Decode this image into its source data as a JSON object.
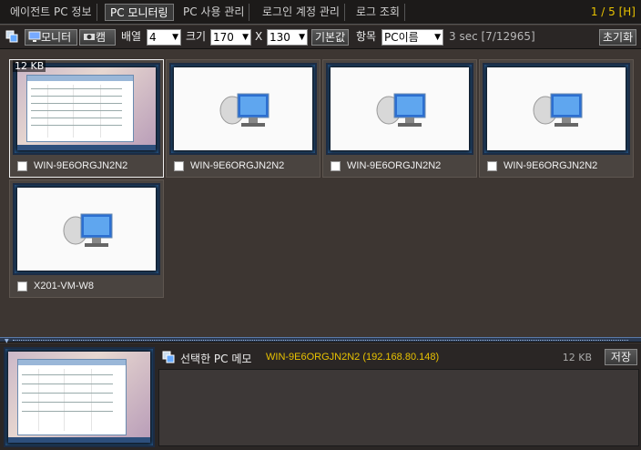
{
  "tabs": [
    {
      "label": "에이전트 PC 정보"
    },
    {
      "label": "PC 모니터링"
    },
    {
      "label": "PC 사용 관리"
    },
    {
      "label": "로그인 계정 관리"
    },
    {
      "label": "로그 조회"
    }
  ],
  "pager": "1 / 5 [H]",
  "toolbar": {
    "monitor_label": "모니터",
    "cam_label": "캠",
    "array_label": "배열",
    "array_value": "4",
    "size_label": "크기",
    "width_value": "170",
    "times": "X",
    "height_value": "130",
    "default_label": "기본값",
    "item_label": "항목",
    "item_value": "PC이름",
    "status": "3 sec [7/12965]",
    "reset_label": "초기화"
  },
  "thumbnails": [
    {
      "name": "WIN-9E6ORGJN2N2",
      "size": "12 KB",
      "preview": "desktop-screenshot"
    },
    {
      "name": "WIN-9E6ORGJN2N2",
      "preview": "network-computer-icon"
    },
    {
      "name": "WIN-9E6ORGJN2N2",
      "preview": "network-computer-icon"
    },
    {
      "name": "WIN-9E6ORGJN2N2",
      "preview": "network-computer-icon"
    },
    {
      "name": "X201-VM-W8",
      "preview": "network-computer-icon"
    }
  ],
  "memo": {
    "title": "선택한 PC 메모",
    "pc": "WIN-9E6ORGJN2N2 (192.168.80.148)",
    "size": "12 KB",
    "save_label": "저장"
  },
  "colors": {
    "accent_yellow": "#e8c200",
    "screen_glow": "#2e6fb0",
    "panel_bg": "#3d3632"
  }
}
